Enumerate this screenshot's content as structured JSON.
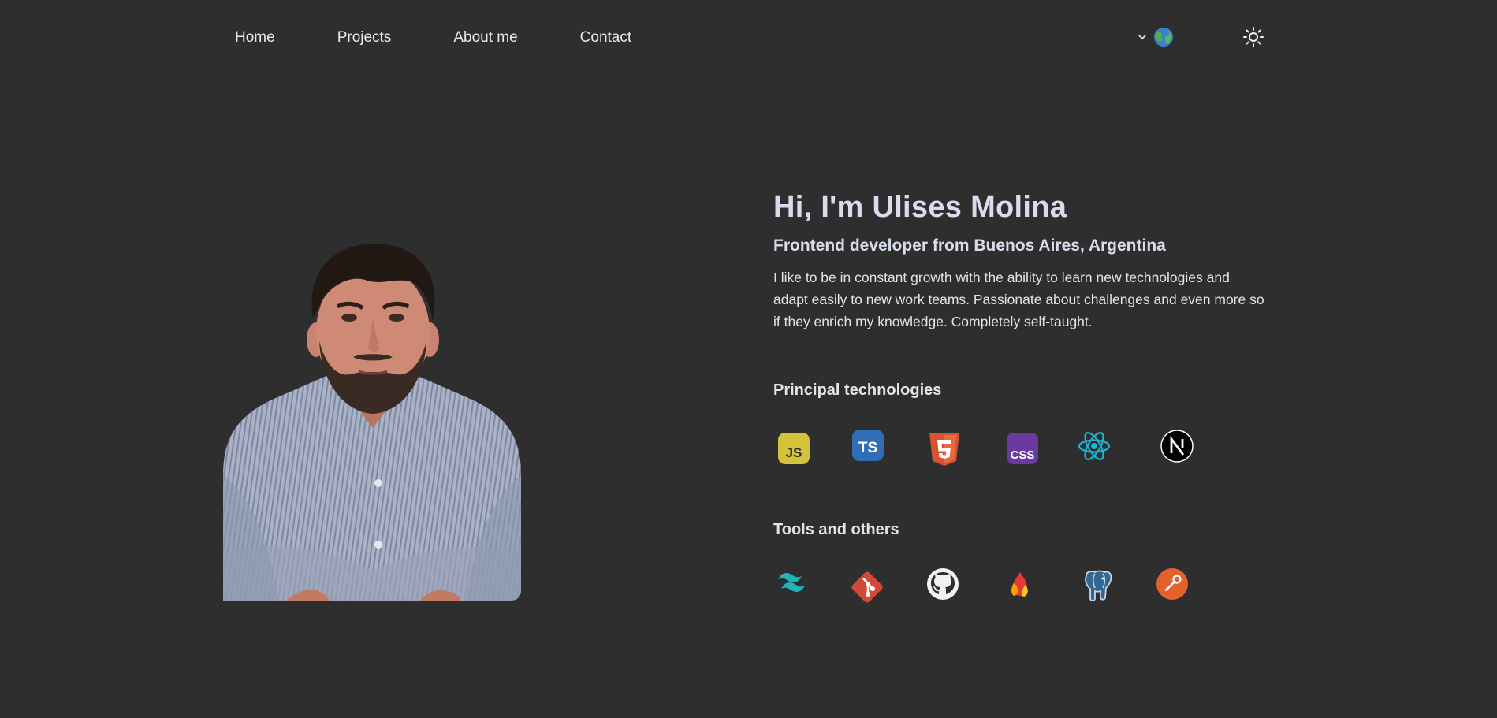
{
  "nav": {
    "links": [
      "Home",
      "Projects",
      "About me",
      "Contact"
    ],
    "language_icon": "globe-icon",
    "dropdown_icon": "chevron-down-icon",
    "theme_icon": "sun-icon"
  },
  "hero": {
    "photo": "profile-photo",
    "title": "Hi, I'm Ulises Molina",
    "subtitle": "Frontend developer from Buenos Aires, Argentina",
    "bio": "I like to be in constant growth with the ability to learn new technologies and adapt easily to new work teams. Passionate about challenges and even more so if they enrich my knowledge. Completely self-taught."
  },
  "technologies": {
    "title": "Principal technologies",
    "icons": [
      "javascript-icon",
      "typescript-icon",
      "html5-icon",
      "css-icon",
      "react-icon",
      "nextjs-icon"
    ]
  },
  "tools": {
    "title": "Tools and others",
    "icons": [
      "tailwind-icon",
      "git-icon",
      "github-icon",
      "firebase-icon",
      "postgresql-icon",
      "postman-icon"
    ]
  },
  "colors": {
    "background": "#2e2e2e",
    "heading": "#d9dcec",
    "text": "#e4e4e4"
  }
}
